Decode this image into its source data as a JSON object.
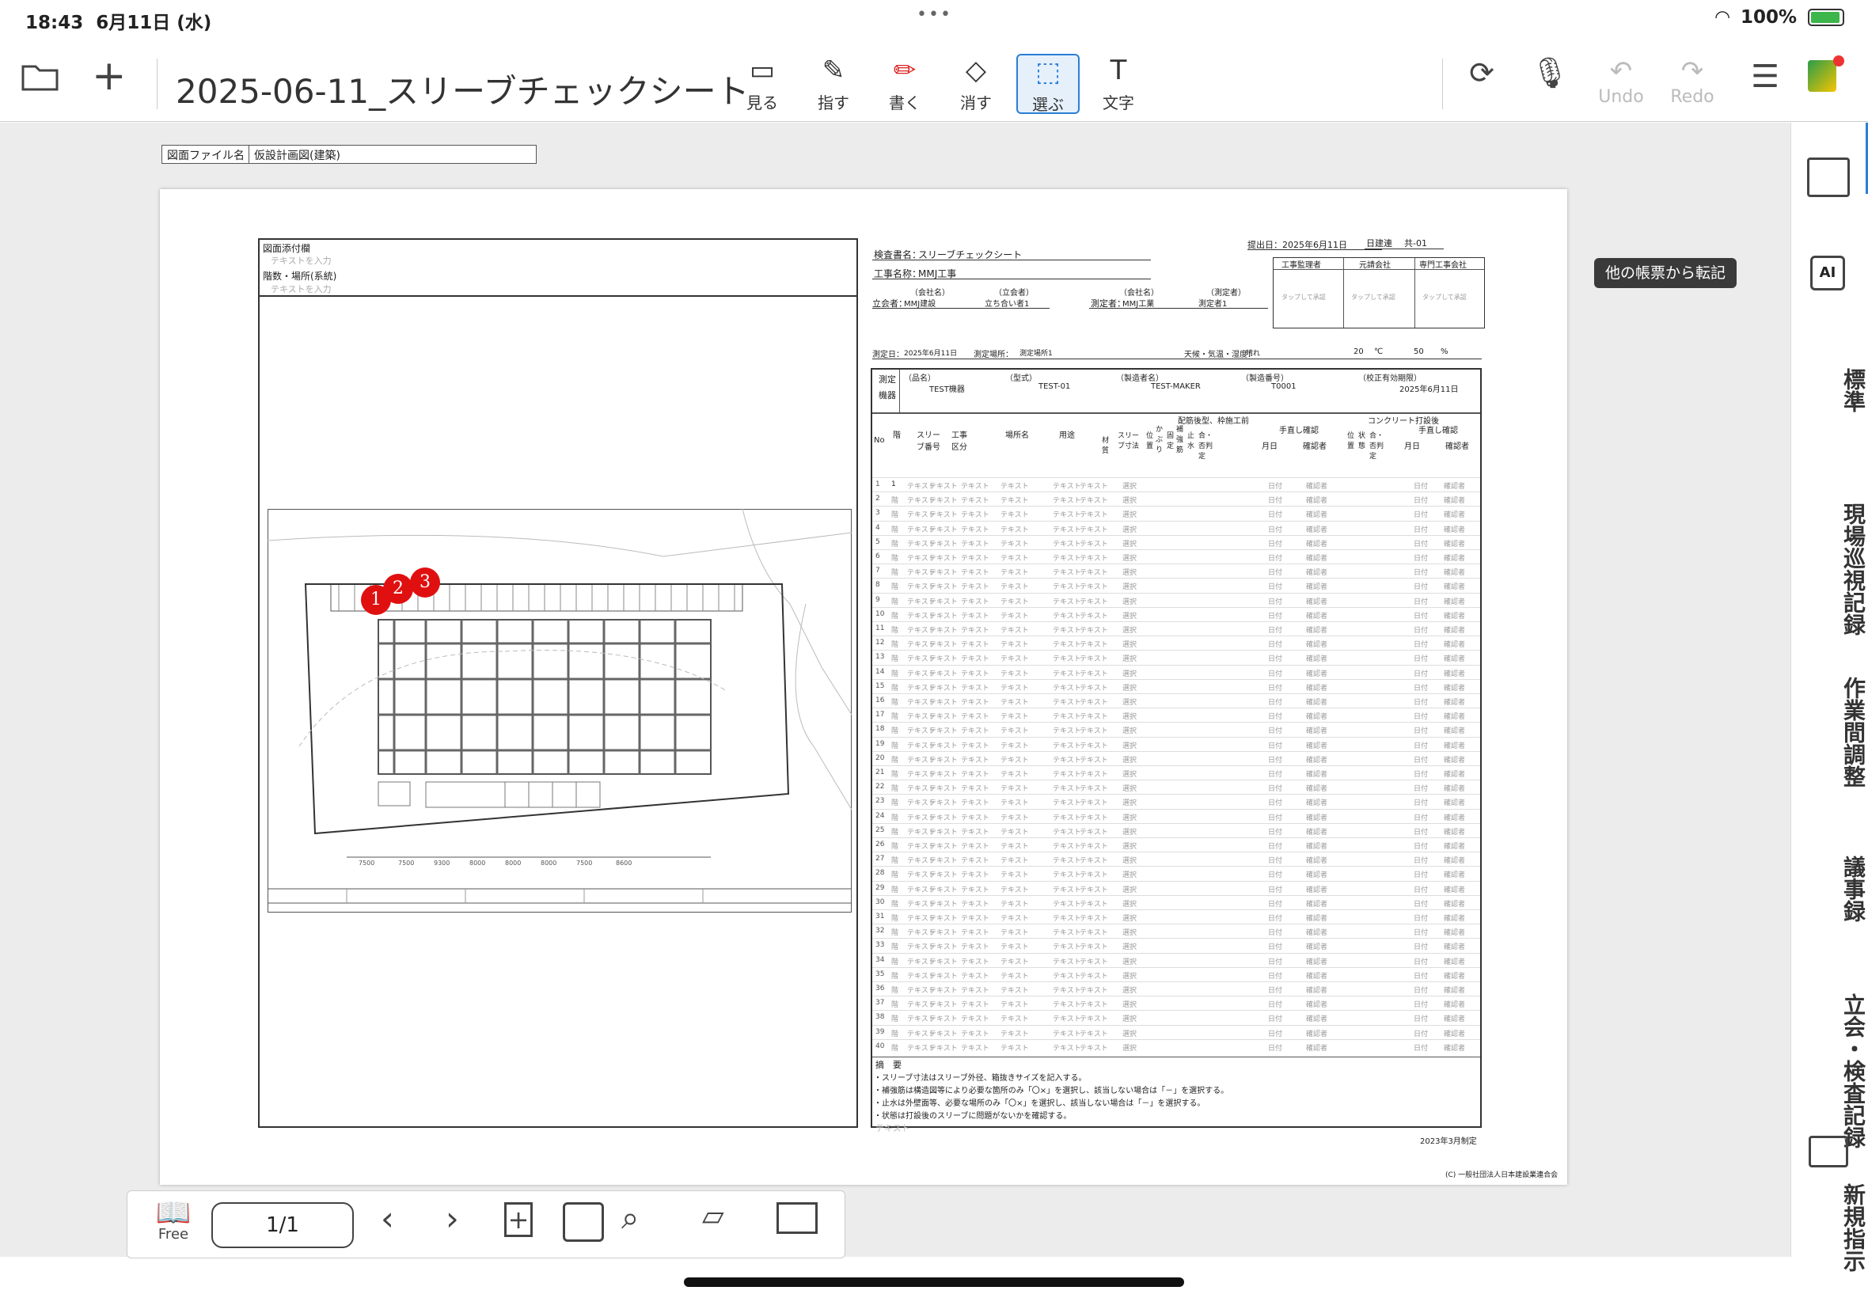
{
  "status_bar": {
    "time": "18:43",
    "date": "6月11日 (水)",
    "battery": "100%"
  },
  "toolbar": {
    "title": "2025-06-11_スリーブチェックシート",
    "tools": [
      {
        "label": "見る",
        "icon": "view-icon"
      },
      {
        "label": "指す",
        "icon": "pointer-icon"
      },
      {
        "label": "書く",
        "icon": "pen-icon"
      },
      {
        "label": "消す",
        "icon": "eraser-icon"
      },
      {
        "label": "選ぶ",
        "icon": "select-icon",
        "active": true
      },
      {
        "label": "文字",
        "icon": "text-icon"
      }
    ],
    "undo_label": "Undo",
    "redo_label": "Redo"
  },
  "document": {
    "filename_key": "図面ファイル名",
    "filename_value": "仮設計画図(建築)",
    "left": {
      "attach_label": "図面添付欄",
      "attach_placeholder": "テキストを入力",
      "floor_label": "階数・場所(系統)",
      "floor_placeholder": "テキストを入力",
      "markers": [
        "1",
        "2",
        "3"
      ]
    },
    "header": {
      "submit_label": "提出日：",
      "submit_date": "2025年6月11日",
      "doc_no_label": "日建連",
      "doc_no": "共-01",
      "inspection_label": "検査書名：",
      "inspection_name": "スリーブチェックシート",
      "project_label": "工事名称：",
      "project_name": "MMJ工事",
      "company_label": "（会社名）",
      "witness_label": "（立会者）",
      "witness_role": "立会者：",
      "witness_company": "MMJ建設",
      "witness_name": "立ち合い者1",
      "measurer_role": "測定者：",
      "measurer_company_label": "（会社名）",
      "measurer_label": "（測定者）",
      "measurer_company": "MMJ工業",
      "measurer_name": "測定者1",
      "approvals": [
        "工事監理者",
        "元請会社",
        "専門工事会社"
      ],
      "approval_placeholder": "タップして承認",
      "measure_date_label": "測定日：",
      "measure_date": "2025年6月11日",
      "measure_place_label": "測定場所：",
      "measure_place": "測定場所1",
      "weather_label": "天候・気温・湿度：",
      "weather": "晴れ",
      "temp": "20",
      "temp_unit": "℃",
      "humidity": "50",
      "humidity_unit": "%",
      "device_label1": "測定",
      "device_label2": "機器",
      "device_cols": [
        "（品名）",
        "（型式）",
        "（製造者名）",
        "（製造番号）",
        "（校正有効期限）"
      ],
      "device_vals": [
        "TEST機器",
        "TEST-01",
        "TEST-MAKER",
        "T0001",
        "2025年6月11日"
      ]
    },
    "table": {
      "col_no": "No",
      "col_floor": "階",
      "col_sleeve_no": "スリーブ番号",
      "col_work": "工事区分",
      "col_place": "場所名",
      "col_use": "用途",
      "group1": "配筋後型、枠施工前",
      "group2": "コンクリート打設後",
      "g1_cols": [
        "材質",
        "スリーブ寸法",
        "位置",
        "かぶり",
        "固定",
        "補強筋",
        "止水",
        "合・否判定"
      ],
      "g1_confirm": "手直し確認",
      "confirm_cols": [
        "月日",
        "確認者"
      ],
      "g2_cols": [
        "位置",
        "状態",
        "合・否判定"
      ],
      "g2_confirm": "手直し確認",
      "row_count": 40,
      "first_row_floor": "1",
      "cell_text": "テキスト",
      "cell_pick": "選択",
      "cell_date": "日付",
      "cell_confirmer": "確認者",
      "cell_floor": "階"
    },
    "summary": {
      "title": "摘　要",
      "lines": [
        "・スリーブ寸法はスリーブ外径、箱抜きサイズを記入する。",
        "・補強筋は構造図等により必要な箇所のみ「〇×」を選択し、該当しない場合は「－」を選択する。",
        "・止水は外壁面等、必要な場所のみ「〇×」を選択し、該当しない場合は「－」を選択する。",
        "・状態は打設後のスリーブに問題がないかを確認する。"
      ],
      "placeholder": "テキスト",
      "revision": "2023年3月制定",
      "copyright": "(C) 一般社団法人日本建設業連合会"
    }
  },
  "sidebar": {
    "tooltip": "他の帳票から転記",
    "items": [
      "標準",
      "現場巡視記録",
      "作業間調整",
      "議事録",
      "立会・検査記録",
      "新規指示"
    ]
  },
  "bottom_bar": {
    "free_label": "Free",
    "page": "1/1"
  }
}
